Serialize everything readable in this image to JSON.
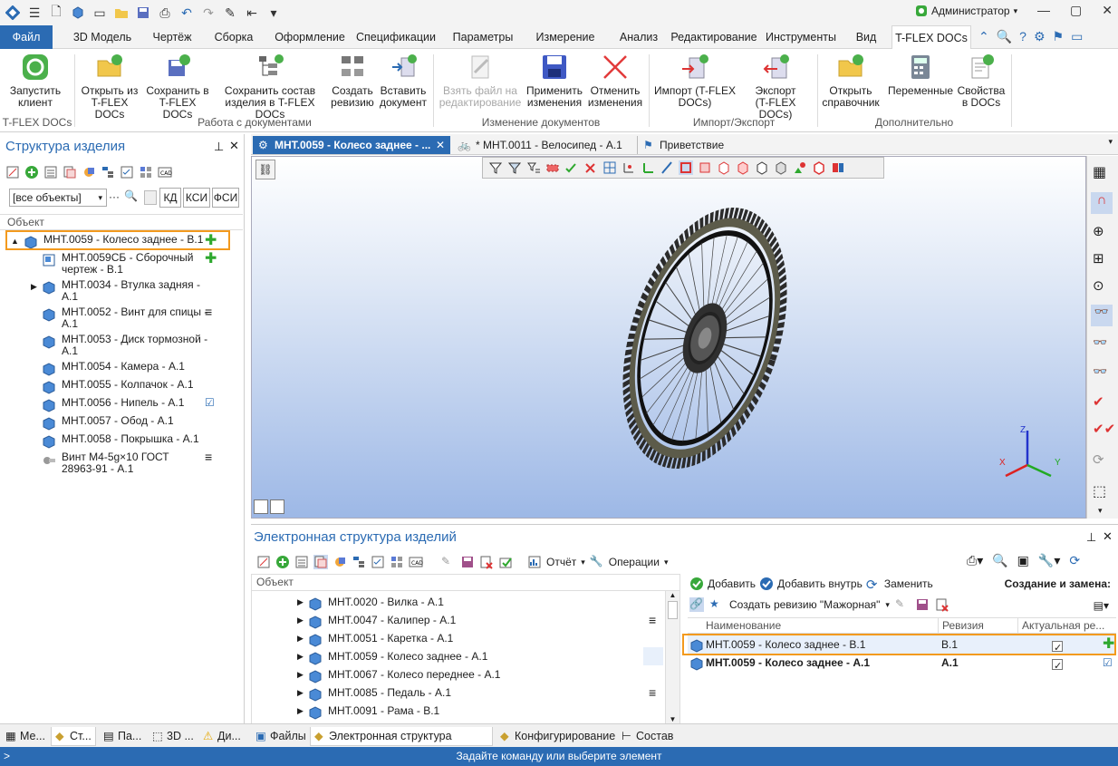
{
  "titlebar": {
    "user": "Администратор",
    "user_caret": "▾"
  },
  "tabs": [
    {
      "label": "Файл"
    },
    {
      "label": "3D Модель"
    },
    {
      "label": "Чертёж"
    },
    {
      "label": "Сборка"
    },
    {
      "label": "Оформление"
    },
    {
      "label": "Спецификации"
    },
    {
      "label": "Параметры"
    },
    {
      "label": "Измерение"
    },
    {
      "label": "Анализ"
    },
    {
      "label": "Редактирование"
    },
    {
      "label": "Инструменты"
    },
    {
      "label": "Вид"
    },
    {
      "label": "T-FLEX DOCs"
    }
  ],
  "ribbon": {
    "buttons": [
      {
        "label1": "Запустить",
        "label2": "клиент"
      },
      {
        "label1": "Открыть из",
        "label2": "T-FLEX DOCs"
      },
      {
        "label1": "Сохранить в",
        "label2": "T-FLEX DOCs"
      },
      {
        "label1": "Сохранить состав",
        "label2": "изделия в T-FLEX DOCs"
      },
      {
        "label1": "Создать",
        "label2": "ревизию"
      },
      {
        "label1": "Вставить",
        "label2": "документ"
      },
      {
        "label1": "Взять файл на",
        "label2": "редактирование"
      },
      {
        "label1": "Применить",
        "label2": "изменения"
      },
      {
        "label1": "Отменить",
        "label2": "изменения"
      },
      {
        "label1": "Импорт (T-FLEX",
        "label2": "DOCs)"
      },
      {
        "label1": "Экспорт",
        "label2": "(T-FLEX DOCs)"
      },
      {
        "label1": "Открыть",
        "label2": "справочник"
      },
      {
        "label1": "Переменные",
        "label2": ""
      },
      {
        "label1": "Свойства",
        "label2": "в DOCs"
      }
    ],
    "groups": [
      "T-FLEX DOCs",
      "Работа с документами",
      "Изменение документов",
      "Импорт/Экспорт",
      "Дополнительно"
    ]
  },
  "left_panel": {
    "title": "Структура изделия",
    "filter_value": "[все объекты]",
    "filter_buttons": [
      "КД",
      "КСИ",
      "ФСИ"
    ],
    "column": "Объект",
    "tree": [
      {
        "line1": "МНТ.0059 - Колесо заднее - В.1",
        "line2": "",
        "status": "plus",
        "expand": "▲"
      },
      {
        "line1": "МНТ.0059СБ - Сборочный",
        "line2": "чертеж - В.1",
        "status": "plus",
        "expand": ""
      },
      {
        "line1": "МНТ.0034 - Втулка задняя -",
        "line2": "А.1",
        "status": "",
        "expand": "▶"
      },
      {
        "line1": "МНТ.0052 - Винт для спицы -",
        "line2": "А.1",
        "status": "menu",
        "expand": ""
      },
      {
        "line1": "МНТ.0053 - Диск тормозной -",
        "line2": "А.1",
        "status": "",
        "expand": ""
      },
      {
        "line1": "МНТ.0054 - Камера - А.1",
        "line2": "",
        "status": "",
        "expand": ""
      },
      {
        "line1": "МНТ.0055 - Колпачок - А.1",
        "line2": "",
        "status": "",
        "expand": ""
      },
      {
        "line1": "МНТ.0056 - Нипель - А.1",
        "line2": "",
        "status": "check",
        "expand": ""
      },
      {
        "line1": "МНТ.0057 - Обод - А.1",
        "line2": "",
        "status": "",
        "expand": ""
      },
      {
        "line1": "МНТ.0058 - Покрышка - А.1",
        "line2": "",
        "status": "",
        "expand": ""
      },
      {
        "line1": "Винт М4-5g×10 ГОСТ",
        "line2": "28963-91 - А.1",
        "status": "menu",
        "expand": ""
      }
    ]
  },
  "doc_tabs": [
    {
      "label": "МНТ.0059 - Колесо заднее - ..."
    },
    {
      "label": "* МНТ.0011 - Велосипед - А.1"
    },
    {
      "label": "Приветствие"
    }
  ],
  "viewport": {
    "axis_x": "X",
    "axis_y": "Y",
    "axis_z": "Z"
  },
  "esi": {
    "title": "Электронная структура изделий",
    "report_label": "Отчёт",
    "operations_label": "Операции",
    "column": "Объект",
    "rows": [
      {
        "label": "МНТ.0020 - Вилка - А.1",
        "status": ""
      },
      {
        "label": "МНТ.0047 - Калипер - А.1",
        "status": "menu"
      },
      {
        "label": "МНТ.0051 - Каретка - А.1",
        "status": ""
      },
      {
        "label": "МНТ.0059 - Колесо заднее - А.1",
        "status": ""
      },
      {
        "label": "МНТ.0067 - Колесо переднее - А.1",
        "status": ""
      },
      {
        "label": "МНТ.0085 - Педаль - А.1",
        "status": "menu"
      },
      {
        "label": "МНТ.0091 - Рама - В.1",
        "status": ""
      }
    ],
    "right": {
      "add_label": "Добавить",
      "add_inside_label": "Добавить внутрь",
      "replace_label": "Заменить",
      "create_replace_label": "Создание и замена:",
      "create_revision_label": "Создать ревизию \"Мажорная\"",
      "columns": [
        "Наименование",
        "Ревизия",
        "Актуальная ре..."
      ],
      "rows": [
        {
          "name": "МНТ.0059 - Колесо заднее - В.1",
          "revision": "В.1",
          "bold": false
        },
        {
          "name": "МНТ.0059 - Колесо заднее - А.1",
          "revision": "А.1",
          "bold": true
        }
      ]
    }
  },
  "bottom_tabs": [
    {
      "label": "Ме..."
    },
    {
      "label": "Ст..."
    },
    {
      "label": "Па..."
    },
    {
      "label": "3D ..."
    },
    {
      "label": "Ди..."
    },
    {
      "label": "Файлы"
    },
    {
      "label": "Электронная структура изделий"
    },
    {
      "label": "Конфигурирование"
    },
    {
      "label": "Состав изделия"
    }
  ],
  "status_text": "Задайте команду или выберите элемент",
  "status_prompt": ">"
}
